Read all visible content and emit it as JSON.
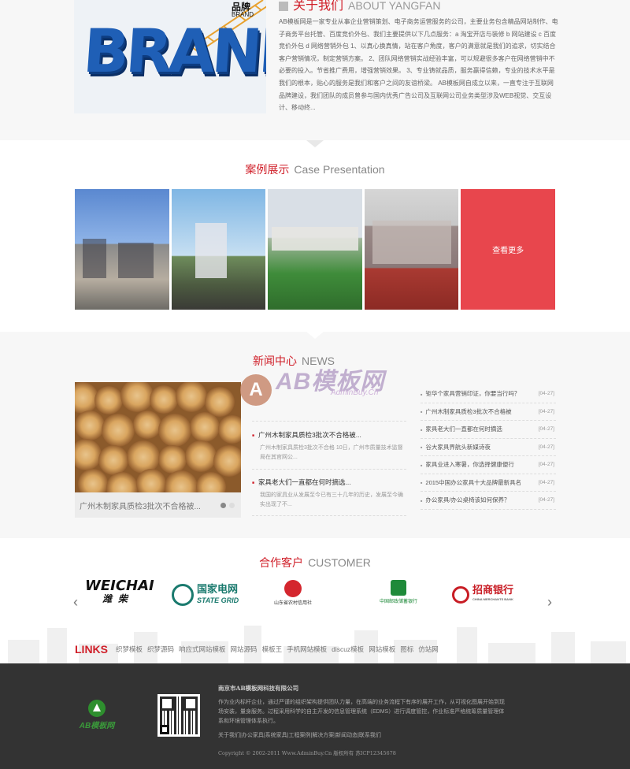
{
  "about": {
    "title_cn": "关于我们",
    "title_en": "ABOUT YANGFAN",
    "brand_word": "BRAND",
    "brand_tag_cn": "品牌",
    "brand_tag_en": "BRAND",
    "text": "AB模板网是一家专业从事企业营销策划、电子商务运营服务的公司，主要业务包含精品网站制作、电子商务平台托管、百度竞价外包、我们主要提供以下几点服务：a 淘宝开店与装修 b 网站建设 c 百度竞价外包 d 网络营销外包 1、以真心换真情，站在客户角度，客户的满意就是我们的追求，切实结合客户营销情况，制定营销方案。 2、团队网络营销实战经验丰富，可以规避很多客户在网络营销中不必要的投入。节省推广费用，增强营销效果。 3、专业铸就品质，服务赢得信赖，专业的技术水平是我们的根本，贴心的服务是我们和客户之间的友谊桥梁。 AB模板网自成立以来，一直专注于互联网品牌建设，我们团队的成员曾参与国内优秀广告公司及互联网公司业务类型涉及WEB视觉、交互设计、移动终..."
  },
  "cases": {
    "title_cn": "案例展示",
    "title_en": "Case Presentation",
    "more_label": "查看更多"
  },
  "news": {
    "title_cn": "新闻中心",
    "title_en": "NEWS",
    "photo_caption": "广州木制家具质检3批次不合格被...",
    "middle": [
      {
        "title": "广州木制家具质检3批次不合格被...",
        "desc": "广州木制家具质检3批次不合格 10日，广州市质量技术监督局在其官网公..."
      },
      {
        "title": "家具老大们一直都在何时摘选...",
        "desc": "我国的家具业从发展至今已有三十几年的历史，发展至今确实出现了不..."
      }
    ],
    "right": [
      {
        "title": "钜华个家具营销印证，你要当行吗？",
        "date": "[04-27]"
      },
      {
        "title": "广州木制家具质检3批次不合格被",
        "date": "[04-27]"
      },
      {
        "title": "家具老大们一直都在何时摘选",
        "date": "[04-27]"
      },
      {
        "title": "谷大家具界航头新媒诗夜",
        "date": "[04-27]"
      },
      {
        "title": "家具业进入寒暑，你选择健康便行",
        "date": "[04-27]"
      },
      {
        "title": "2015中国办公家具十大品牌最新具名",
        "date": "[04-27]"
      },
      {
        "title": "办公家具/办公桌椅该如何保养？",
        "date": "[04-27]"
      }
    ],
    "watermark": "AB模板网",
    "watermark_url": "AdminBuy.Cn"
  },
  "customers": {
    "title_cn": "合作客户",
    "title_en": "CUSTOMER",
    "logos": [
      {
        "name": "WEICHAI",
        "sub": "潍柴"
      },
      {
        "name": "国家电网",
        "sub": "STATE GRID"
      },
      {
        "name": "山东省农村信用社",
        "sub": ""
      },
      {
        "name": "中国邮政储蓄银行",
        "sub": ""
      },
      {
        "name": "招商银行",
        "sub": "CHINA MERCHANTS BANK"
      }
    ]
  },
  "links": {
    "label": "LINKS",
    "items": [
      "织梦模板",
      "织梦源码",
      "响应式网站模板",
      "网站源码",
      "模板王",
      "手机网站模板",
      "discuz模板",
      "网站模板",
      "图标",
      "仿站网"
    ]
  },
  "footer": {
    "logo_text": "AB模板网",
    "company": "南京市AB模板网科技有限公司",
    "desc": "作为业内标杆企业，通过严谨的组织架构提供团队力量，在高端的业务流程下有序的展开工作，从可视化图展开始到现场安装，量身服务。过程采用科学的自主开发的信息管理系统（EDMS）进行调度管控，作业标准严格统筹质量管理体系和环境管理体系执行。",
    "nav": "关于我们|办公家具|系统家具|工程案例|解决方案|新闻动态|联系我们",
    "copyright": "Copyright © 2002-2011 Www.AdminBuy.Cn 版权所有  苏ICP12345678"
  },
  "colors": {
    "accent": "#d0202a",
    "footer_bg": "#333333",
    "more_bg": "#e8464d"
  }
}
